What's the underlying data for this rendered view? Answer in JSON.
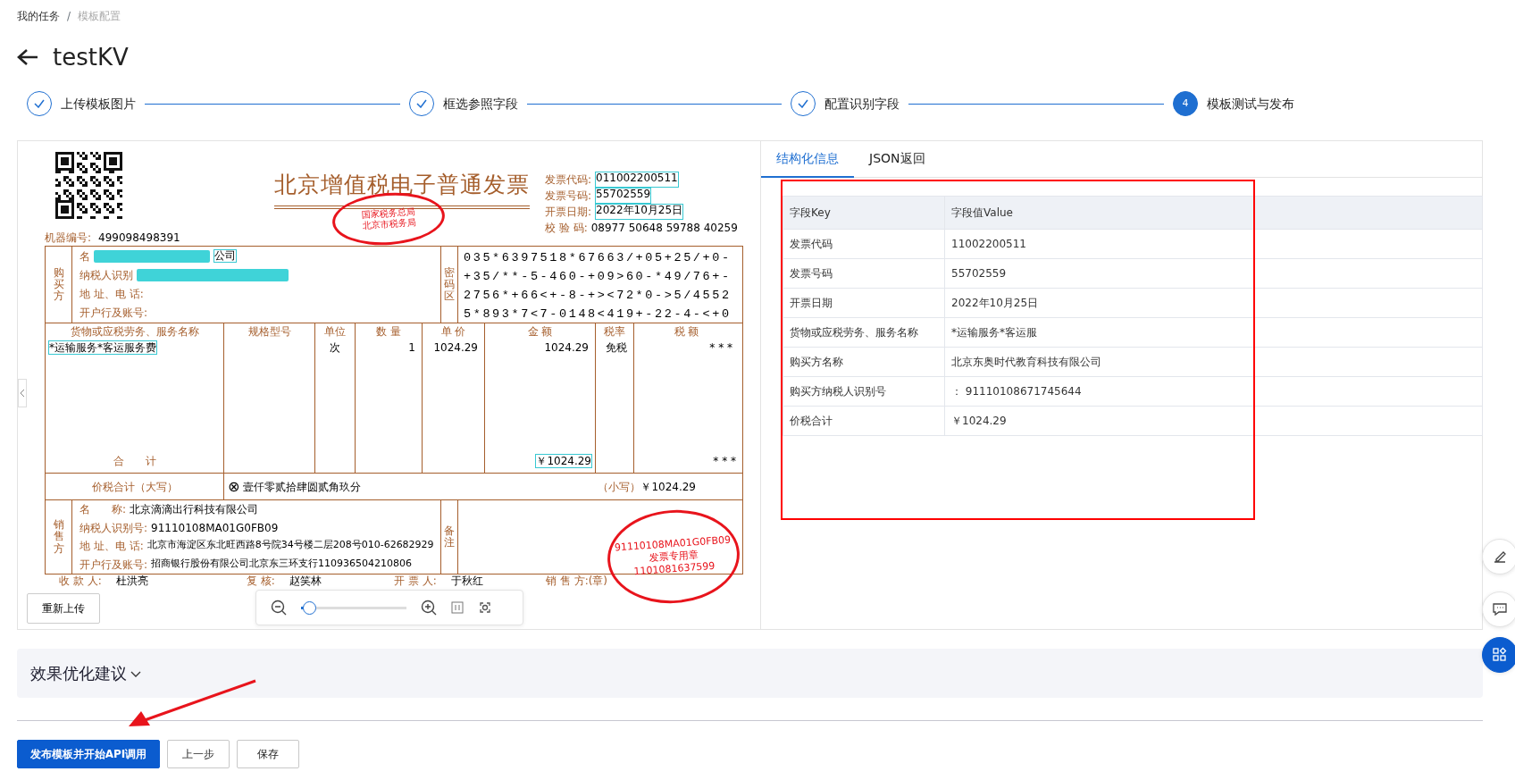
{
  "breadcrumb": [
    {
      "text": "我的任务",
      "current": false
    },
    {
      "text": "模板配置",
      "current": true
    }
  ],
  "breadcrumb_separator": "/",
  "title": "testKV",
  "steps": [
    {
      "label": "上传模板图片",
      "completed": true
    },
    {
      "label": "框选参照字段",
      "completed": true
    },
    {
      "label": "配置识别字段",
      "completed": true
    },
    {
      "number": "4",
      "label": "模板测试与发布",
      "completed": false
    }
  ],
  "invoice": {
    "title": "北京增值税电子普通发票",
    "meta": [
      {
        "label": "发票代码:",
        "value": "011002200511",
        "boxed": true
      },
      {
        "label": "发票号码:",
        "value": "55702559",
        "boxed": true
      },
      {
        "label": "开票日期:",
        "value": "2022年10月25日",
        "boxed": true
      },
      {
        "label": "校 验 码:",
        "value": "08977 50648 59788 40259",
        "boxed": false
      }
    ],
    "machine": {
      "label": "机器编号:",
      "value": "499098498391"
    },
    "buyer": {
      "side_label": "购买方",
      "fields": [
        {
          "label": "名",
          "value": "公司",
          "redacted": true,
          "boxed": true
        },
        {
          "label": "纳税人识别",
          "redacted": true
        },
        {
          "label": "地 址、电 话:"
        },
        {
          "label": "开户行及账号:"
        }
      ]
    },
    "cipher_label": "密码区",
    "cipher": [
      "035*6397518*67663/+05+25/+0-",
      "+35/**-5-460-+09>60-*49/76+-",
      "2756*+66<+-8-+><72*0->5/4552",
      "5*893*7<7-0148<419+-22-4-<+0"
    ],
    "item_columns": [
      "货物或应税劳务、服务名称",
      "规格型号",
      "单位",
      "数 量",
      "单 价",
      "金 额",
      "税率",
      "税 额"
    ],
    "items": [
      {
        "name": "*运输服务*客运服务费",
        "boxed": true,
        "cells": [
          null,
          "次",
          "1",
          "1024.29",
          "1024.29",
          "免税",
          "* * *"
        ]
      }
    ],
    "subtotal": {
      "label": "合　　计",
      "amount": "￥1024.29",
      "amount_boxed": true,
      "tax": "* * *"
    },
    "total": {
      "label": "价税合计（大写）",
      "mark": "⊗",
      "words": "壹仟零贰拾肆圆贰角玖分",
      "small_label": "（小写）",
      "amount": "￥1024.29"
    },
    "seller": {
      "side_label": "销售方",
      "fields": [
        {
          "label": "名　　称:",
          "value": "北京滴滴出行科技有限公司"
        },
        {
          "label": "纳税人识别号:",
          "value": "91110108MA01G0FB09"
        },
        {
          "label": "地 址、电 话:",
          "value": "北京市海淀区东北旺西路8号院34号楼二层208号010-62682929"
        },
        {
          "label": "开户行及账号:",
          "value": "招商银行股份有限公司北京东三环支行110936504210806"
        }
      ]
    },
    "note_label": "备注",
    "signatures": [
      {
        "label": "收 款 人:",
        "value": "杜洪亮"
      },
      {
        "label": "复 核:",
        "value": "赵笑林"
      },
      {
        "label": "开 票 人:",
        "value": "于秋红"
      },
      {
        "label": "销 售 方:(章)"
      }
    ],
    "stamps": [
      {
        "kind": "tax",
        "texts": [
          "国家税务总局",
          "北京市税务局"
        ]
      },
      {
        "kind": "seller",
        "texts": [
          "91110108MA01G0FB09",
          "发票专用章",
          "1101081637599"
        ]
      }
    ]
  },
  "reupload_button": "重新上传",
  "zoom": {
    "level": 0.08
  },
  "result_tabs": [
    {
      "label": "结构化信息",
      "selected": true
    },
    {
      "label": "JSON返回",
      "selected": false
    }
  ],
  "result_table": {
    "columns": [
      "字段Key",
      "字段值Value"
    ],
    "rows": [
      [
        "发票代码",
        "11002200511"
      ],
      [
        "发票号码",
        "55702559"
      ],
      [
        "开票日期",
        "2022年10月25日"
      ],
      [
        "货物或应税劳务、服务名称",
        "*运输服务*客运服"
      ],
      [
        "购买方名称",
        "北京东奥时代教育科技有限公司"
      ],
      [
        "购买方纳税人识别号",
        "：  91110108671745644"
      ],
      [
        "价税合计",
        "￥1024.29"
      ]
    ]
  },
  "suggestions": {
    "title": "效果优化建议",
    "expanded": false
  },
  "buttons": [
    {
      "label": "发布模板并开始API调用",
      "kind": "primary"
    },
    {
      "label": "上一步",
      "kind": "secondary"
    },
    {
      "label": "保存",
      "kind": "secondary"
    }
  ]
}
